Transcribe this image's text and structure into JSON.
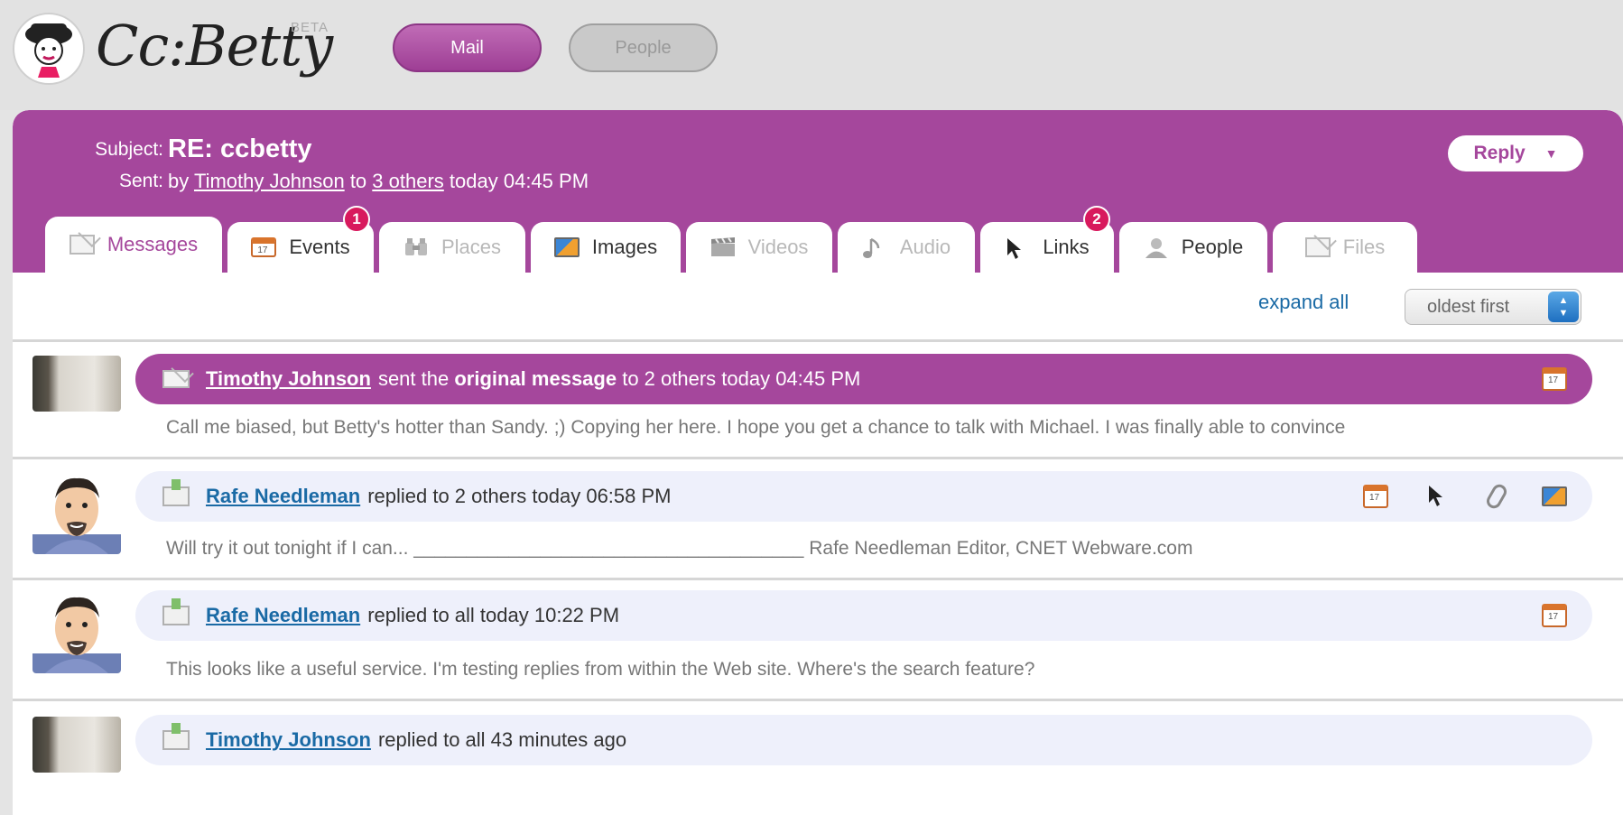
{
  "app": {
    "logo_text": "Cc:Betty",
    "beta_label": "BETA",
    "nav": {
      "mail_label": "Mail",
      "people_label": "People"
    }
  },
  "header": {
    "subject_label": "Subject:",
    "subject": "RE: ccbetty",
    "sent_label": "Sent:",
    "sent_by": "by",
    "sender": "Timothy Johnson",
    "sent_to": "to",
    "recipients": "3 others",
    "sent_time": "today 04:45 PM",
    "reply_label": "Reply",
    "reply_caret": "▼"
  },
  "tabs": [
    {
      "label": "Messages",
      "icon": "envelope-icon",
      "state": "active"
    },
    {
      "label": "Events",
      "icon": "calendar-icon",
      "badge": "1"
    },
    {
      "label": "Places",
      "icon": "binoculars-icon",
      "state": "disabled"
    },
    {
      "label": "Images",
      "icon": "image-icon"
    },
    {
      "label": "Videos",
      "icon": "clapperboard-icon",
      "state": "disabled"
    },
    {
      "label": "Audio",
      "icon": "music-note-icon",
      "state": "disabled"
    },
    {
      "label": "Links",
      "icon": "cursor-icon",
      "badge": "2"
    },
    {
      "label": "People",
      "icon": "person-icon"
    },
    {
      "label": "Files",
      "icon": "envelope-icon",
      "state": "disabled"
    }
  ],
  "toolbar": {
    "expand_all": "expand all",
    "sort_value": "oldest first"
  },
  "messages": [
    {
      "name": "Timothy Johnson",
      "text_before": "sent the",
      "text_bold": "original message",
      "text_after": "to 2 others today 04:45 PM",
      "snippet": "Call me biased, but Betty's hotter than Sandy. ;) Copying her here. I hope you get a chance to talk with Michael. I was finally able to convince"
    },
    {
      "name": "Rafe Needleman",
      "text_after": "replied to 2 others today 06:58 PM",
      "snippet": "Will try it out tonight if I can... _____________________________________ Rafe Needleman Editor, CNET Webware.com"
    },
    {
      "name": "Rafe Needleman",
      "text_after": "replied to all today 10:22 PM",
      "snippet": "This looks like a useful service. I'm testing replies from within the Web site. Where's the search feature?"
    },
    {
      "name": "Timothy Johnson",
      "text_after": "replied to all 43 minutes ago"
    }
  ],
  "colors": {
    "brand_purple": "#a5479c",
    "link_blue": "#1a6aa5",
    "badge_red": "#d8195d",
    "collapsed_bar": "#eef0fb"
  }
}
